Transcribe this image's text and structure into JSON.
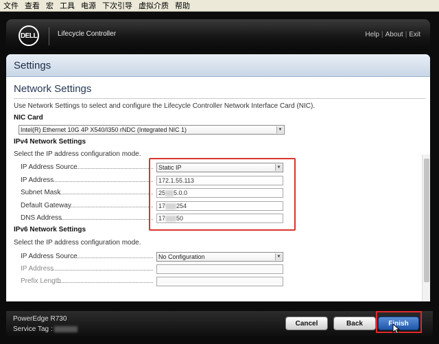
{
  "menubar": {
    "items": [
      "文件",
      "查看",
      "宏",
      "工具",
      "电源",
      "下次引导",
      "虚拟介质",
      "帮助"
    ]
  },
  "header": {
    "logo_text": "DELL",
    "app_title": "Lifecycle Controller",
    "links": [
      "Help",
      "About",
      "Exit"
    ]
  },
  "page": {
    "heading": "Settings",
    "section_title": "Network Settings",
    "description": "Use Network Settings to select and configure the Lifecycle Controller Network Interface Card (NIC)."
  },
  "nic": {
    "heading": "NIC Card",
    "selected": "Intel(R) Ethernet 10G 4P X540/I350 rNDC (Integrated NIC 1)"
  },
  "ipv4": {
    "heading": "IPv4 Network Settings",
    "description": "Select the IP address configuration mode.",
    "source_label": "IP Address Source",
    "source_value": "Static IP",
    "ip_label": "IP Address",
    "ip_value": "172.1.55.113",
    "subnet_label": "Subnet Mask",
    "subnet_prefix": "25",
    "subnet_suffix": "5.0.0",
    "gateway_label": "Default Gateway",
    "gateway_prefix": "17",
    "gateway_suffix": "254",
    "dns_label": "DNS Address",
    "dns_prefix": "17",
    "dns_suffix": "50"
  },
  "ipv6": {
    "heading": "IPv6 Network Settings",
    "description": "Select the IP address configuration mode.",
    "source_label": "IP Address Source",
    "source_value": "No Configuration",
    "ip_label": "IP Address",
    "prefix_label": "Prefix Length"
  },
  "footer": {
    "model": "PowerEdge R730",
    "service_tag_label": "Service Tag :",
    "cancel_label": "Cancel",
    "back_label": "Back",
    "finish_label": "Finish"
  },
  "colors": {
    "accent": "#1f56a8",
    "highlight_border": "#d9342b"
  }
}
